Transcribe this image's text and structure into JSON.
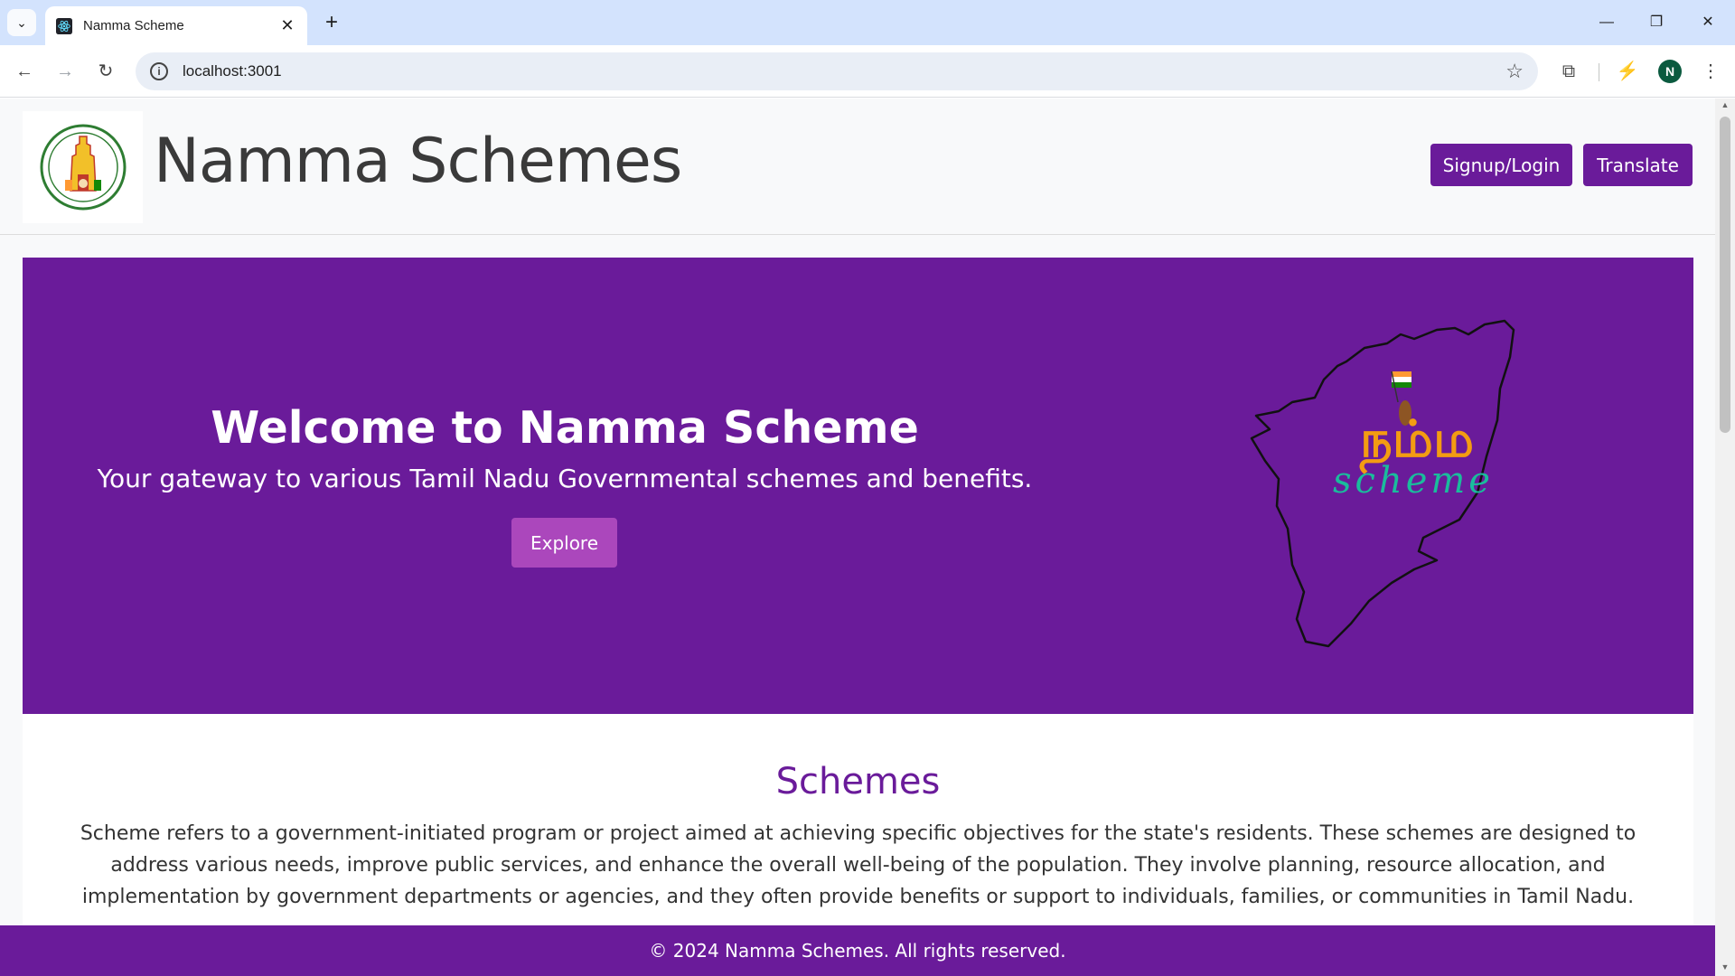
{
  "browser": {
    "tab_title": "Namma Scheme",
    "url": "localhost:3001",
    "profile_initial": "N"
  },
  "header": {
    "site_title": "Namma Schemes",
    "signup_label": "Signup/Login",
    "translate_label": "Translate"
  },
  "hero": {
    "title": "Welcome to Namma Scheme",
    "subtitle": "Your gateway to various Tamil Nadu Governmental schemes and benefits.",
    "explore_label": "Explore",
    "logo_tamil": "நம்ம",
    "logo_english": "scheme"
  },
  "schemes": {
    "title": "Schemes",
    "description": "Scheme refers to a government-initiated program or project aimed at achieving specific objectives for the state's residents. These schemes are designed to address various needs, improve public services, and enhance the overall well-being of the population. They involve planning, resource allocation, and implementation by government departments or agencies, and they often provide benefits or support to individuals, families, or communities in Tamil Nadu."
  },
  "footer": {
    "text": "© 2024 Namma Schemes. All rights reserved."
  },
  "colors": {
    "brand_purple": "#6a1b9a",
    "button_light_purple": "#ab47bc",
    "tab_bar": "#d3e3fd"
  }
}
